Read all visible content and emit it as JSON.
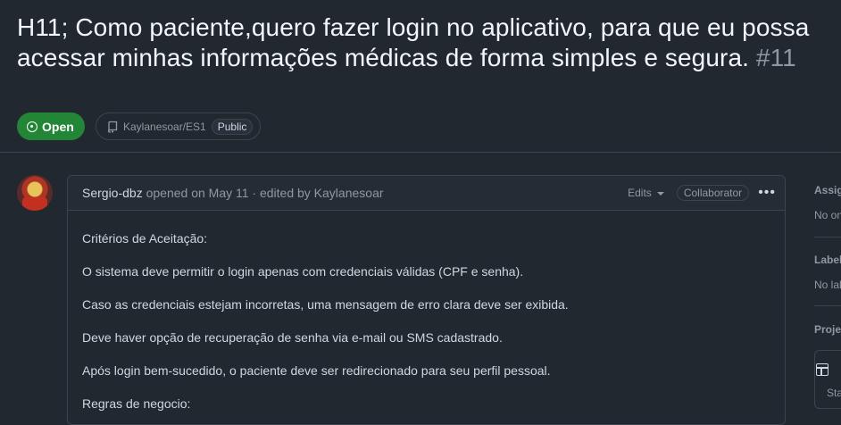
{
  "issue": {
    "title": "H11; Como paciente,quero fazer login no aplicativo, para que eu possa acessar minhas informações médicas de forma simples e segura.",
    "number": "#11",
    "state": "Open",
    "repo": "Kaylanesoar/ES1",
    "visibility": "Public"
  },
  "comment": {
    "author": "Sergio-dbz",
    "meta": "opened on May 11 · edited by Kaylanesoar",
    "edits_label": "Edits",
    "role_badge": "Collaborator",
    "more_label": "•••",
    "body": [
      "Critérios de Aceitação:",
      "O sistema deve permitir o login apenas com credenciais válidas (CPF e senha).",
      "Caso as credenciais estejam incorretas, uma mensagem de erro clara deve ser exibida.",
      "Deve haver opção de recuperação de senha via e-mail ou SMS cadastrado.",
      "Após login bem-sucedido, o paciente deve ser redirecionado para seu perfil pessoal.",
      "Regras de negocio:"
    ]
  },
  "sidebar": {
    "assignees_heading": "Assig",
    "assignees_value": "No on",
    "labels_heading": "Label",
    "labels_value": "No lal",
    "projects_heading": "Proje",
    "project_status": "Sta"
  },
  "colors": {
    "background": "#212830",
    "open_green": "#238636",
    "border": "#3d444d"
  }
}
